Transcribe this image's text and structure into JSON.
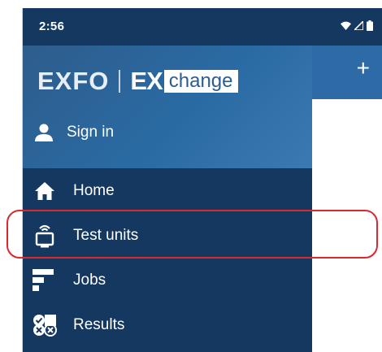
{
  "status_bar": {
    "time": "2:56",
    "icons": [
      "wifi-icon",
      "signal-icon",
      "battery-icon"
    ]
  },
  "app_bar": {
    "add_label": "+"
  },
  "drawer": {
    "logo": {
      "brand": "EXFO",
      "product_prefix": "EX",
      "product_suffix": "change"
    },
    "sign_in_label": "Sign in",
    "items": [
      {
        "label": "Home",
        "icon": "home-icon"
      },
      {
        "label": "Test units",
        "icon": "test-unit-icon"
      },
      {
        "label": "Jobs",
        "icon": "jobs-icon"
      },
      {
        "label": "Results",
        "icon": "results-icon"
      }
    ]
  },
  "colors": {
    "drawer_bg": "#14385f",
    "header_bg": "#2a6aa3",
    "app_bar_bg": "#2d6aa6",
    "highlight": "#d9282f"
  }
}
